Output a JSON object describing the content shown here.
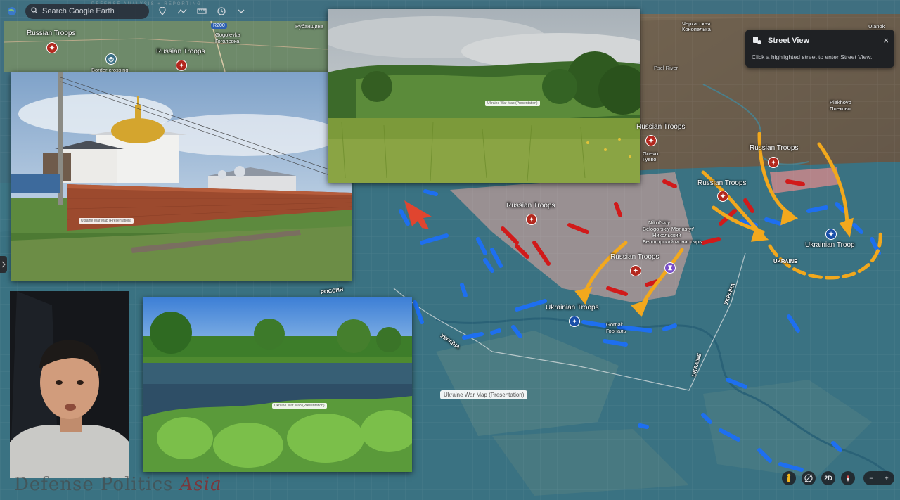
{
  "toolbar": {
    "search_placeholder": "Search Google Earth",
    "icons": [
      "earth-logo-icon",
      "search-icon",
      "pin-icon",
      "path-icon",
      "ruler-icon",
      "history-icon",
      "chevron-down-icon"
    ]
  },
  "tagline": "DEFENSE ANALYSIS + REPORTING",
  "street_view": {
    "title": "Street View",
    "hint": "Click a highlighted street to enter Street View.",
    "close": "×"
  },
  "photo_labels": {
    "church": "Ukraine War Map (Presentation)",
    "field": "Ukraine War Map (Presentation)",
    "river": "Ukraine War Map (Presentation)",
    "map_chip": "Ukraine War Map (Presentation)"
  },
  "top_strip": {
    "russian_troops_1": "Russian Troops",
    "russian_troops_2": "Russian Troops",
    "border_crossing": "Border crossing",
    "road_badge": "R200",
    "gogolevka_lat": "Gogolevka",
    "gogolevka_cyr": "Гоголевка",
    "rubanshchina": "Рубанщина"
  },
  "map_labels": {
    "russian_troops_a": "Russian Troops",
    "russian_troops_b": "Russian Troops",
    "russian_troops_c": "Russian Troops",
    "russian_troops_d": "Russian Troops",
    "russian_troops_e": "Russian Troops",
    "ukrainian_troops_a": "Ukrainian Troops",
    "ukrainian_troop_b": "Ukrainian Troop",
    "monastery_1": "Nikol'skiy",
    "monastery_2": "Belogorskiy Monastyr'",
    "monastery_3": "Никольский",
    "monastery_4": "Белогорский монастырь",
    "gornal_lat": "Gornal'",
    "gornal_cyr": "Горналь",
    "guevo_lat": "Guevo",
    "guevo_cyr": "Гуево",
    "plekhovo_lat": "Plekhovo",
    "plekhovo_cyr": "Плехово",
    "cherkasskaya_1": "Черкасская",
    "cherkasskaya_2": "Конопелька",
    "ulanok": "Ulanok",
    "psel_river": "Psel River",
    "russia": "РОССИЯ",
    "ukraina": "УКРАЇНА",
    "ukraine_1": "UKRAINE",
    "ukraine_2": "UKRAINE",
    "ukraine_3": "УКРАЇНА"
  },
  "controls": {
    "mode_2d": "2D",
    "zoom_out": "−",
    "zoom_in": "+",
    "icons": [
      "pegman-icon",
      "tilt-icon",
      "compass-icon"
    ]
  },
  "brand": {
    "main": "Defense Politics ",
    "accent": "Asia"
  },
  "colors": {
    "russian": "#d11a1a",
    "ukrainian": "#1e6ff0",
    "advance_arrow": "#f2a81d",
    "russian_zone": "rgba(232,160,160,0.55)"
  }
}
